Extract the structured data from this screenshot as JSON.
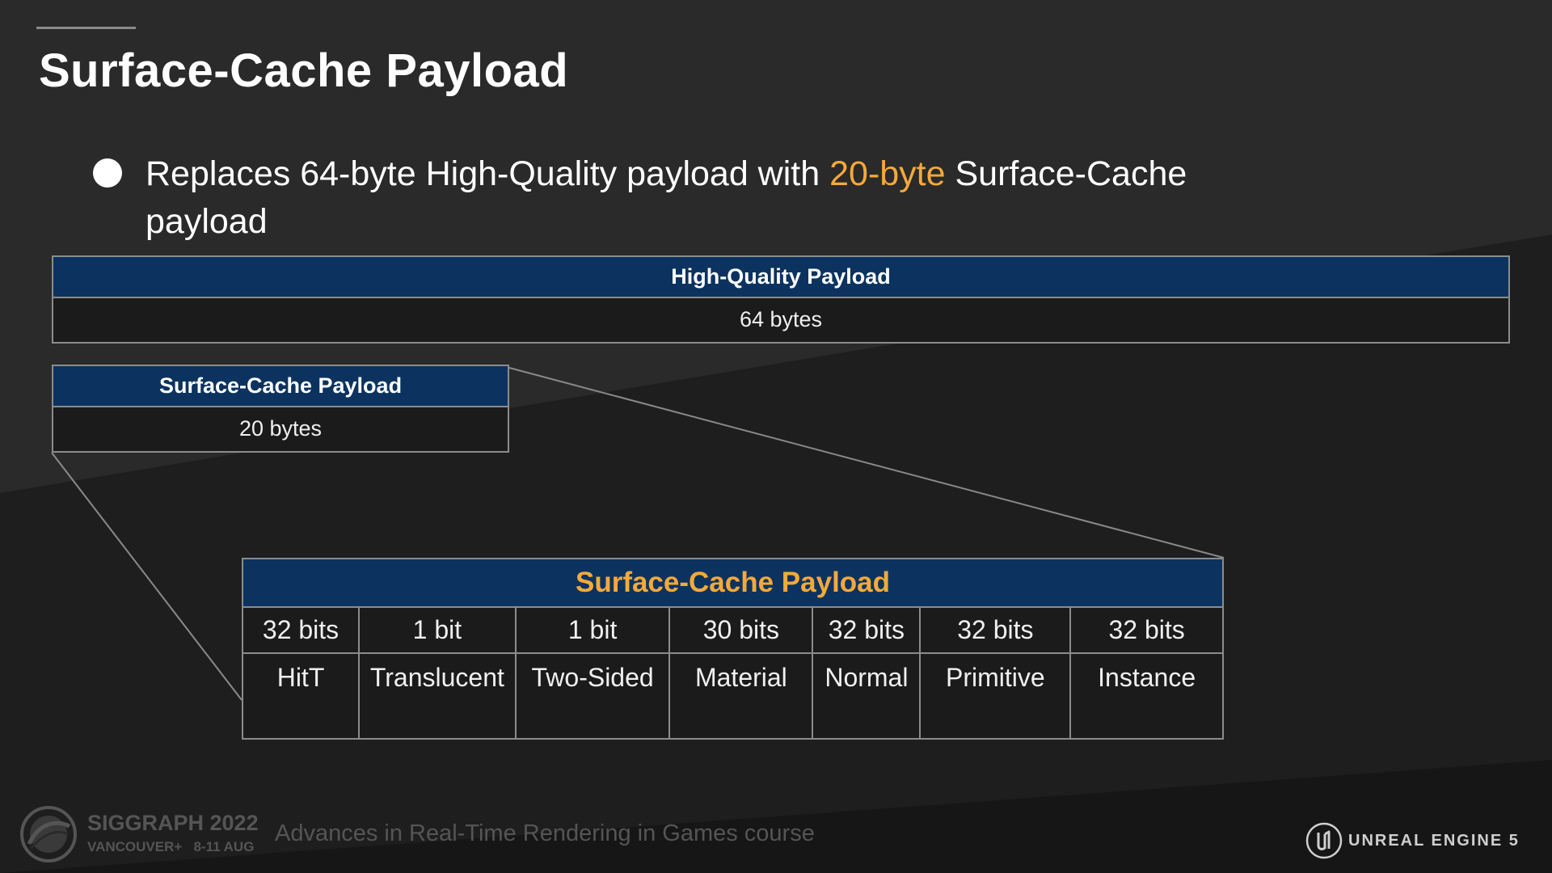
{
  "title": "Surface-Cache Payload",
  "bullet": {
    "before": "Replaces 64-byte High-Quality payload with ",
    "highlight": "20-byte",
    "after": " Surface-Cache payload"
  },
  "hq_payload": {
    "header": "High-Quality Payload",
    "value": "64 bytes"
  },
  "sc_payload": {
    "header": "Surface-Cache Payload",
    "value": "20 bytes"
  },
  "detail": {
    "header": "Surface-Cache Payload",
    "fields": [
      {
        "size": "32 bits",
        "name": "HitT"
      },
      {
        "size": "1 bit",
        "name": "Translucent"
      },
      {
        "size": "1 bit",
        "name": "Two-Sided"
      },
      {
        "size": "30 bits",
        "name": "Material"
      },
      {
        "size": "32 bits",
        "name": "Normal"
      },
      {
        "size": "32 bits",
        "name": "Primitive"
      },
      {
        "size": "32 bits",
        "name": "Instance"
      }
    ]
  },
  "footer": {
    "siggraph_title": "SIGGRAPH 2022",
    "siggraph_sub": "VANCOUVER+   8-11 AUG",
    "course": "Advances in Real-Time Rendering in Games course",
    "engine": "UNREAL ENGINE 5"
  },
  "colors": {
    "background": "#2a2a2a",
    "header_fill": "#0c335f",
    "accent": "#f5a93a",
    "border": "#8c8c8c"
  },
  "icons": [
    "bullet-icon",
    "siggraph-logo-icon",
    "unreal-logo-icon"
  ]
}
